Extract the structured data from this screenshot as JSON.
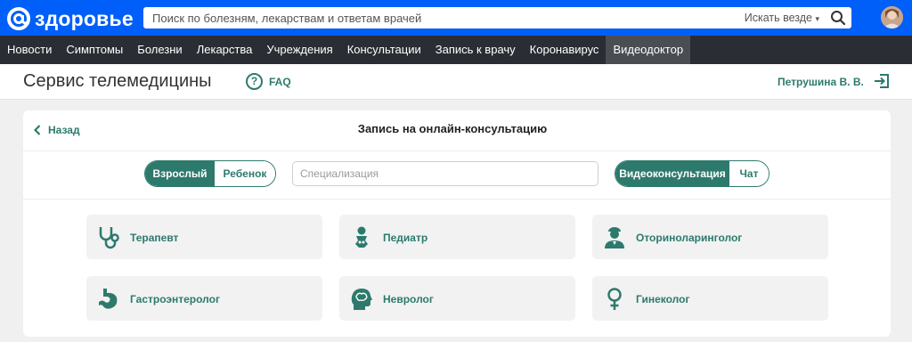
{
  "header": {
    "logo_text": "здоровье",
    "search_placeholder": "Поиск по болезням, лекарствам и ответам врачей",
    "search_scope": "Искать везде",
    "brand_color": "#005ff9"
  },
  "nav": {
    "items": [
      {
        "label": "Новости"
      },
      {
        "label": "Симптомы"
      },
      {
        "label": "Болезни"
      },
      {
        "label": "Лекарства"
      },
      {
        "label": "Учреждения"
      },
      {
        "label": "Консультации"
      },
      {
        "label": "Запись к врачу"
      },
      {
        "label": "Коронавирус"
      },
      {
        "label": "Видеодоктор",
        "active": true
      }
    ]
  },
  "service": {
    "title": "Сервис телемедицины",
    "faq_label": "FAQ",
    "user_name": "Петрушина В. В."
  },
  "card": {
    "back_label": "Назад",
    "title": "Запись на онлайн-консультацию",
    "age_toggle": {
      "options": [
        "Взрослый",
        "Ребенок"
      ],
      "selected": "Взрослый"
    },
    "specialization_placeholder": "Специализация",
    "type_toggle": {
      "options": [
        "Видеоконсультация",
        "Чат"
      ],
      "selected": "Видеоконсультация"
    },
    "specialists": [
      {
        "label": "Терапевт",
        "icon": "stethoscope-icon"
      },
      {
        "label": "Педиатр",
        "icon": "baby-icon"
      },
      {
        "label": "Оториноларинголог",
        "icon": "doctor-icon"
      },
      {
        "label": "Гастроэнтеролог",
        "icon": "stomach-icon"
      },
      {
        "label": "Невролог",
        "icon": "brain-head-icon"
      },
      {
        "label": "Гинеколог",
        "icon": "female-symbol-icon"
      }
    ]
  },
  "colors": {
    "accent": "#2d7a6d",
    "nav_bg": "#2a2d33",
    "nav_active_bg": "#4a4d52"
  }
}
